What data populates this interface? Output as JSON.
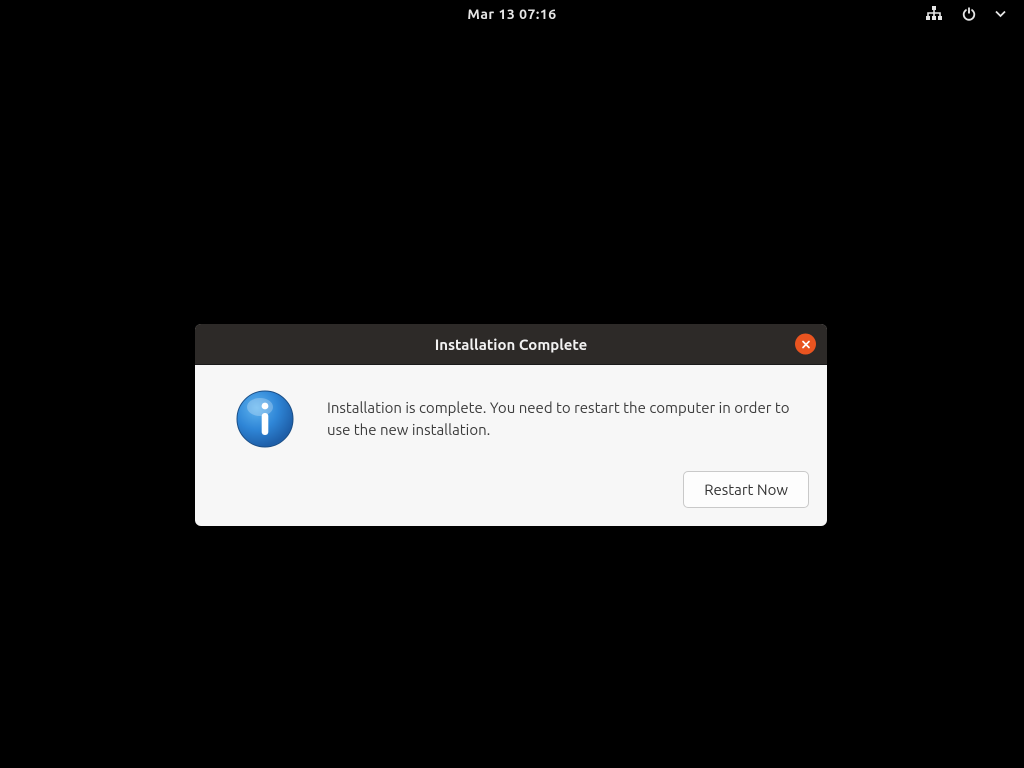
{
  "topbar": {
    "clock": "Mar 13  07:16"
  },
  "dialog": {
    "title": "Installation Complete",
    "message": "Installation is complete. You need to restart the computer in order to use the new installation.",
    "restart_label": "Restart Now"
  }
}
